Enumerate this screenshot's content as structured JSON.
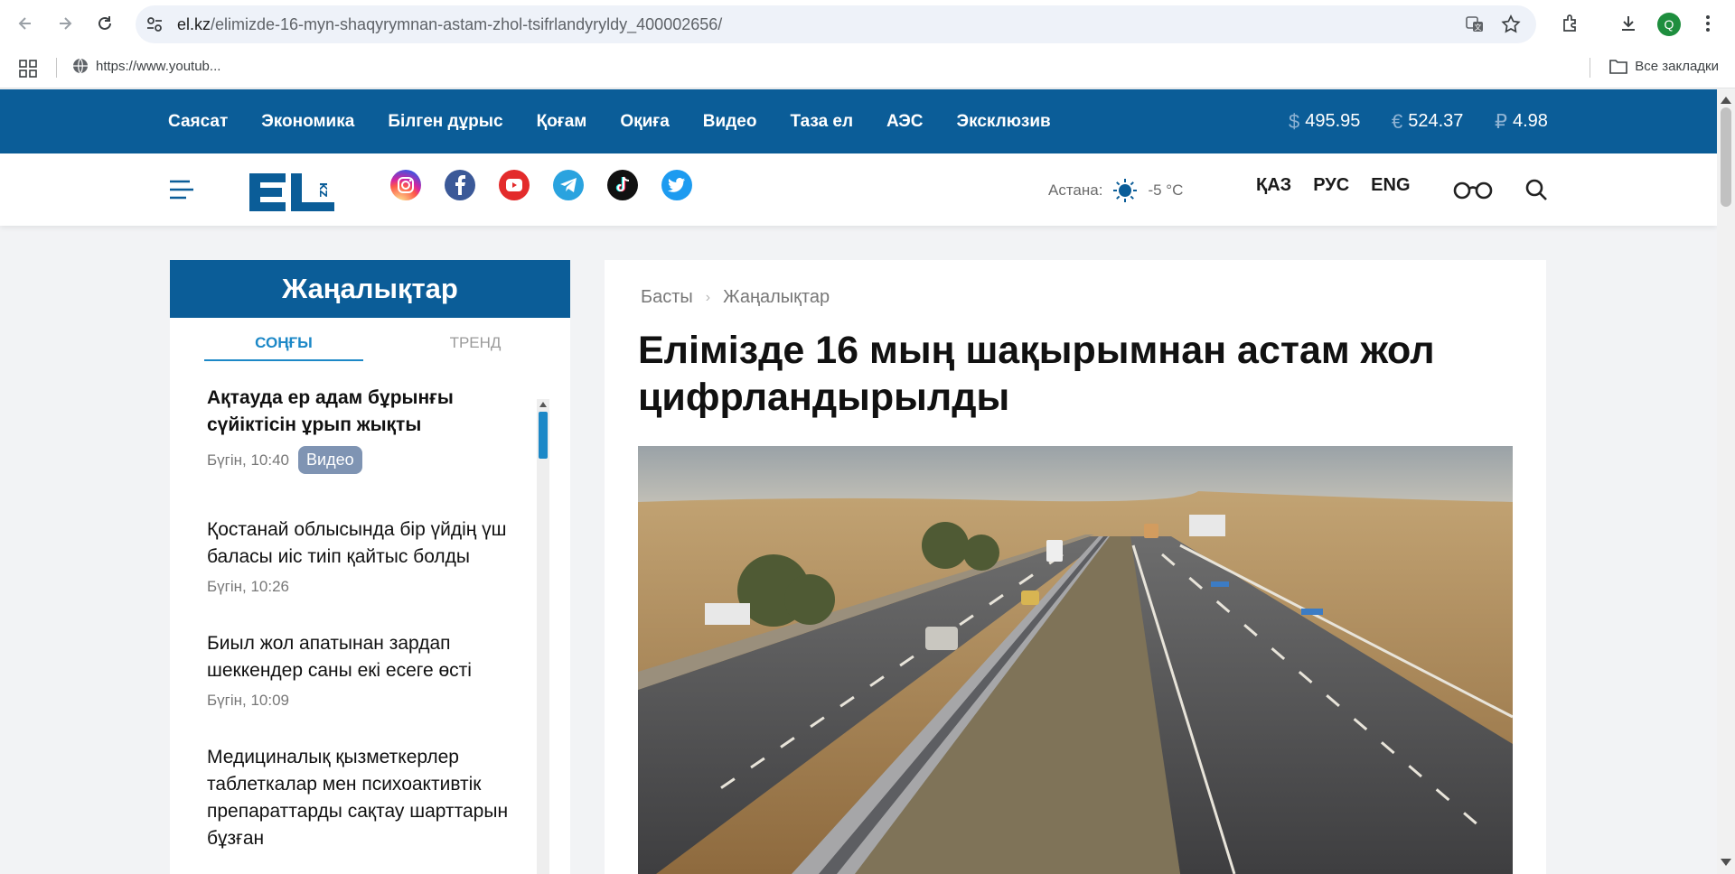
{
  "browser": {
    "url_domain": "el.kz",
    "url_path": "/elimizde-16-myn-shaqyrymnan-astam-zhol-tsifrlandyryldy_400002656/",
    "profile_initial": "Q",
    "bookmark_item": "https://www.youtub...",
    "bookmarks_all": "Все закладки"
  },
  "topnav": {
    "items": [
      "Саясат",
      "Экономика",
      "Білген дұрыс",
      "Қоғам",
      "Оқиға",
      "Видео",
      "Таза ел",
      "АЭС",
      "Эксклюзив"
    ]
  },
  "currency": [
    {
      "symbol": "$",
      "value": "495.95"
    },
    {
      "symbol": "€",
      "value": "524.37"
    },
    {
      "symbol": "₽",
      "value": "4.98"
    }
  ],
  "header": {
    "logo_text": "EL",
    "logo_sub": "KZ",
    "weather_city": "Астана:",
    "weather_temp": "-5 °C",
    "langs": [
      "ҚАЗ",
      "РУС",
      "ENG"
    ],
    "social_icons": [
      "instagram-icon",
      "facebook-icon",
      "youtube-icon",
      "telegram-icon",
      "tiktok-icon",
      "twitter-icon"
    ]
  },
  "sidebar": {
    "title": "Жаңалықтар",
    "tab_latest": "СОҢҒЫ",
    "tab_trend": "ТРЕНД",
    "items": [
      {
        "title": "Ақтауда ер адам бұрынғы сүйіктісін ұрып жықты",
        "time": "Бүгін, 10:40",
        "badge": "Видео"
      },
      {
        "title": "Қостанай облысында бір үйдің үш баласы иіс тиіп қайтыс болды",
        "time": "Бүгін, 10:26"
      },
      {
        "title": "Биыл жол апатынан зардап шеккендер саны екі есеге өсті",
        "time": "Бүгін, 10:09"
      },
      {
        "title": "Медициналық қызметкерлер таблеткалар мен психоактивтік препараттарды сақтау шарттарын бұзған",
        "time": ""
      }
    ]
  },
  "article": {
    "breadcrumb_home": "Басты",
    "breadcrumb_section": "Жаңалықтар",
    "title": "Елімізде 16 мың шақырымнан астам жол цифрландырылды"
  }
}
